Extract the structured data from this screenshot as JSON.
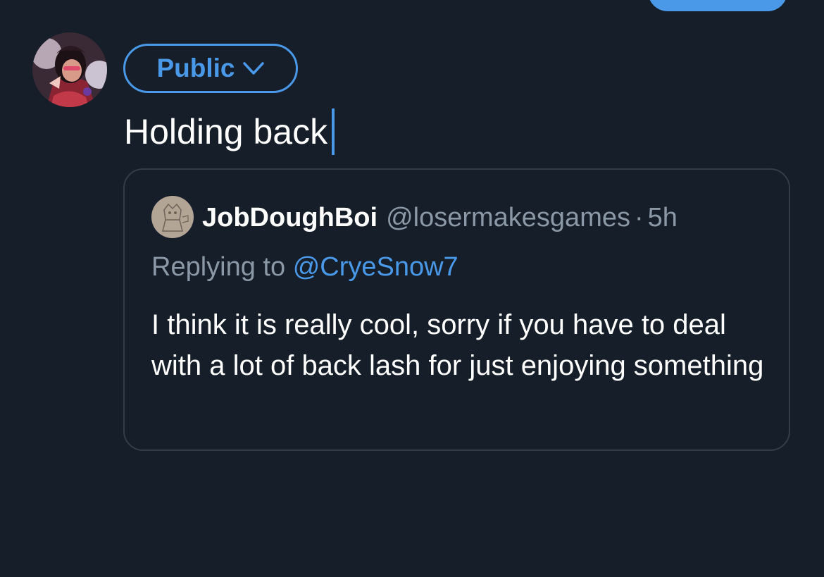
{
  "composer": {
    "audience_label": "Public",
    "draft_text": "Holding back"
  },
  "quoted_tweet": {
    "display_name": "JobDoughBoi",
    "handle": "@losermakesgames",
    "separator": "·",
    "time": "5h",
    "replying_prefix": "Replying to",
    "replying_handle": "@CryeSnow7",
    "text": "I think it is really cool, sorry if you have to deal with a lot of back lash for just enjoying something"
  },
  "icons": {
    "audience_chevron": "chevron-down-icon"
  },
  "colors": {
    "background": "#161e29",
    "accent": "#4a99e9",
    "muted_text": "#8b98a5",
    "card_border": "#333d4a"
  }
}
